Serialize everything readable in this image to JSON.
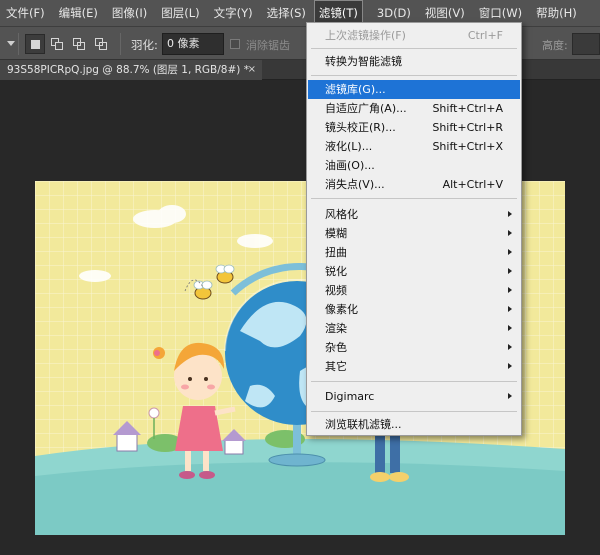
{
  "menubar": {
    "items": [
      "文件(F)",
      "编辑(E)",
      "图像(I)",
      "图层(L)",
      "文字(Y)",
      "选择(S)",
      "滤镜(T)",
      "3D(D)",
      "视图(V)",
      "窗口(W)",
      "帮助(H)"
    ]
  },
  "options": {
    "feather_label": "羽化:",
    "feather_value": "0 像素",
    "antialias_label": "消除锯齿",
    "height_label": "高度:"
  },
  "document_tab": {
    "title": "93S58PICRpQ.jpg @ 88.7% (图层 1, RGB/8#) *",
    "close": "×"
  },
  "filter_menu": {
    "last_filter": {
      "label": "上次滤镜操作(F)",
      "shortcut": "Ctrl+F"
    },
    "convert_smart": "转换为智能滤镜",
    "filter_gallery": "滤镜库(G)...",
    "adaptive_wide_angle": {
      "label": "自适应广角(A)...",
      "shortcut": "Shift+Ctrl+A"
    },
    "lens_correction": {
      "label": "镜头校正(R)...",
      "shortcut": "Shift+Ctrl+R"
    },
    "liquify": {
      "label": "液化(L)...",
      "shortcut": "Shift+Ctrl+X"
    },
    "oil_paint": "油画(O)...",
    "vanishing_point": {
      "label": "消失点(V)...",
      "shortcut": "Alt+Ctrl+V"
    },
    "submenus": [
      "风格化",
      "模糊",
      "扭曲",
      "锐化",
      "视频",
      "像素化",
      "渲染",
      "杂色",
      "其它"
    ],
    "digimarc": "Digimarc",
    "browse_online": "浏览联机滤镜..."
  },
  "colors": {
    "highlight": "#1e73d6",
    "menubar": "#535353",
    "workspace": "#282828"
  }
}
